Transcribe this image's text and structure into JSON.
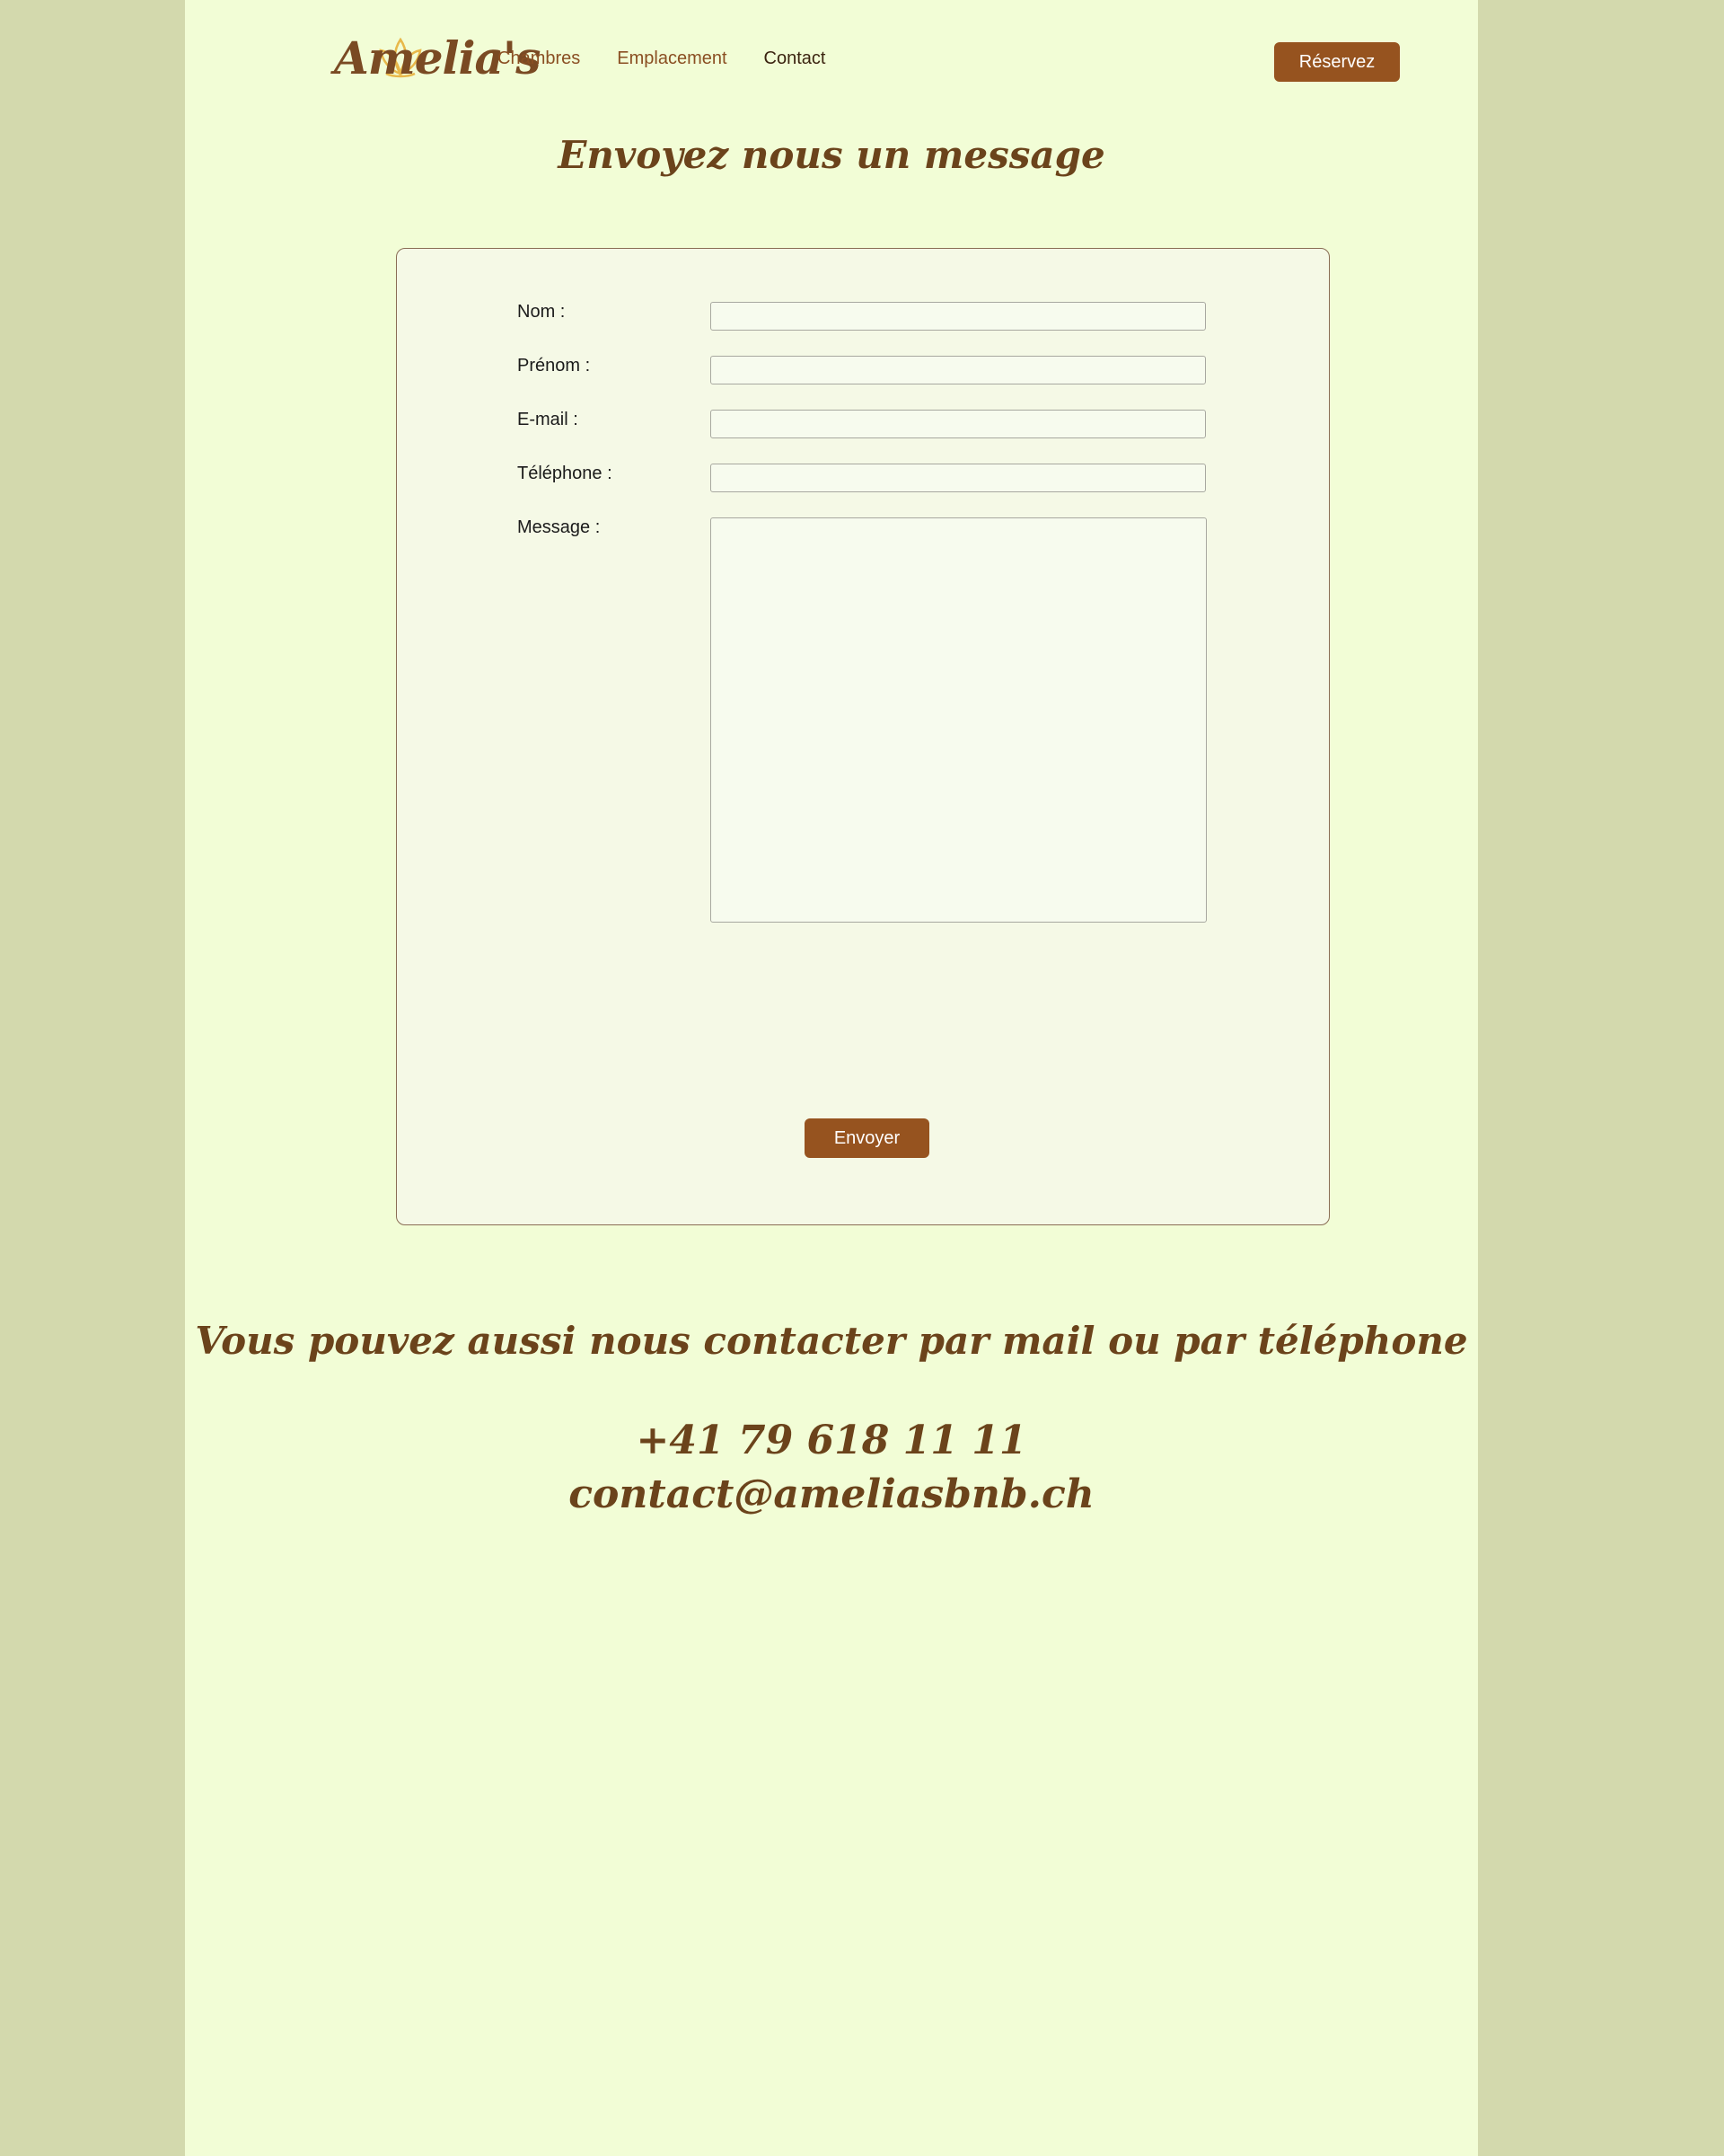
{
  "header": {
    "logo_text": "Amelia's",
    "nav": [
      {
        "label": "Chambres"
      },
      {
        "label": "Emplacement"
      },
      {
        "label": "Contact"
      }
    ],
    "reserve_label": "Réservez"
  },
  "form": {
    "title": "Envoyez nous un message",
    "fields": {
      "nom": {
        "label": "Nom :",
        "value": ""
      },
      "prenom": {
        "label": "Prénom :",
        "value": ""
      },
      "email": {
        "label": "E-mail :",
        "value": ""
      },
      "telephone": {
        "label": "Téléphone :",
        "value": ""
      },
      "message": {
        "label": "Message :",
        "value": ""
      }
    },
    "submit_label": "Envoyer"
  },
  "contact": {
    "title": "Vous pouvez aussi nous contacter par mail ou par téléphone",
    "phone": "+41 79 618 11 11",
    "email": "contact@ameliasbnb.ch"
  },
  "colors": {
    "side_background": "#d3d9ad",
    "page_background": "#f2fdd6",
    "accent": "#96531f",
    "heading": "#6b431b"
  }
}
